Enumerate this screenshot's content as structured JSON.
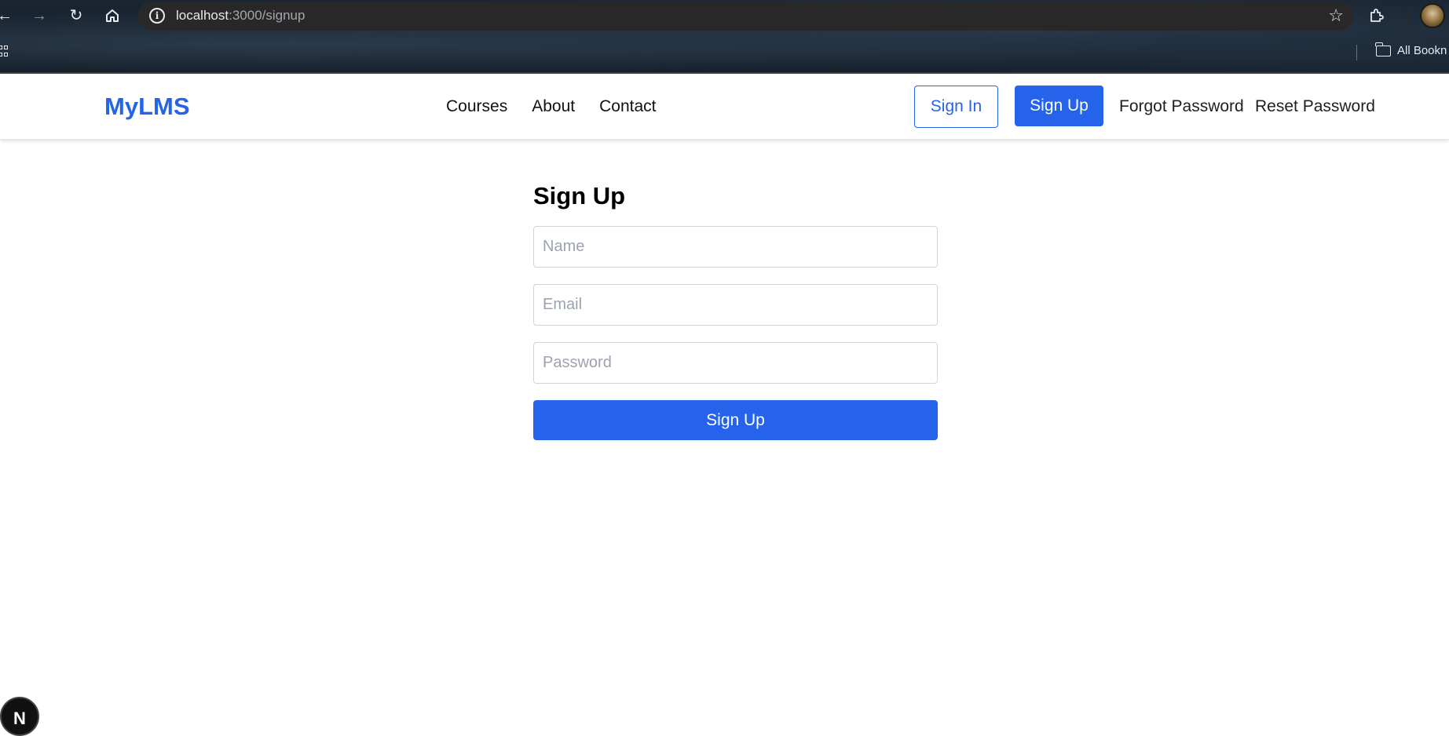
{
  "browser": {
    "url_host": "localhost",
    "url_rest": ":3000/signup",
    "bookmarks_label": "All Bookn",
    "icons": {
      "back": "arrow-left-icon",
      "forward": "arrow-right-icon",
      "reload": "reload-icon",
      "home": "home-icon",
      "site_info": "info-icon",
      "bookmark_star": "star-icon",
      "extensions": "puzzle-icon",
      "apps": "apps-grid-icon",
      "folder": "folder-icon"
    }
  },
  "header": {
    "logo": "MyLMS",
    "nav": [
      {
        "label": "Courses"
      },
      {
        "label": "About"
      },
      {
        "label": "Contact"
      }
    ],
    "sign_in": "Sign In",
    "sign_up": "Sign Up",
    "forgot_password": "Forgot Password",
    "reset_password": "Reset Password"
  },
  "form": {
    "title": "Sign Up",
    "name_placeholder": "Name",
    "name_value": "",
    "email_placeholder": "Email",
    "email_value": "",
    "password_placeholder": "Password",
    "password_value": "",
    "submit_label": "Sign Up"
  },
  "dev_indicator": {
    "label": "N"
  },
  "colors": {
    "brand": "#2563eb",
    "text": "#111111",
    "placeholder": "#9ca3af",
    "input_border": "#d1d5db"
  }
}
